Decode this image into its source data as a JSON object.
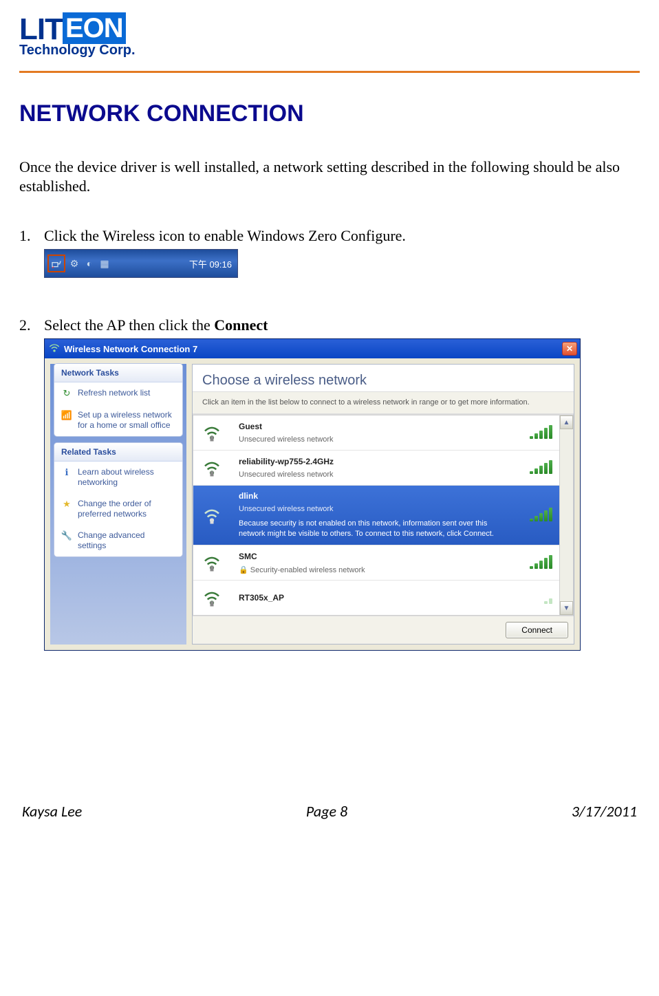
{
  "logo": {
    "brand1": "LIT",
    "brand2": "EON",
    "sub": "Technology Corp."
  },
  "heading": "NETWORK CONNECTION",
  "intro": "Once the device driver is well installed, a network setting described in the following should be also established.",
  "step1": {
    "num": "1.",
    "text": "Click the Wireless icon to enable Windows Zero Configure."
  },
  "tray_time": "下午 09:16",
  "step2": {
    "num": "2.",
    "text_a": "Select the AP then click the ",
    "text_b": "Connect"
  },
  "dlg": {
    "title": "Wireless Network Connection 7",
    "sidebar": {
      "tasks_h": "Network Tasks",
      "tasks": [
        {
          "icon": "↻",
          "label": "Refresh network list"
        },
        {
          "icon": "📶",
          "label": "Set up a wireless network for a home or small office"
        }
      ],
      "related_h": "Related Tasks",
      "related": [
        {
          "icon": "ℹ",
          "label": "Learn about wireless networking"
        },
        {
          "icon": "★",
          "label": "Change the order of preferred networks"
        },
        {
          "icon": "🔧",
          "label": "Change advanced settings"
        }
      ]
    },
    "main_h": "Choose a wireless network",
    "main_sub": "Click an item in the list below to connect to a wireless network in range or to get more information.",
    "networks": [
      {
        "ssid": "Guest",
        "desc": "Unsecured wireless network",
        "selected": false,
        "secure": false
      },
      {
        "ssid": "reliability-wp755-2.4GHz",
        "desc": "Unsecured wireless network",
        "selected": false,
        "secure": false
      },
      {
        "ssid": "dlink",
        "desc": "Unsecured wireless network",
        "selected": true,
        "secure": false,
        "warn": "Because security is not enabled on this network, information sent over this network might be visible to others. To connect to this network, click Connect."
      },
      {
        "ssid": "SMC",
        "desc": "Security-enabled wireless network",
        "selected": false,
        "secure": true
      },
      {
        "ssid": "RT305x_AP",
        "desc": "",
        "selected": false,
        "secure": false
      }
    ],
    "connect": "Connect"
  },
  "footer": {
    "author": "Kaysa Lee",
    "page": "Page 8",
    "date": "3/17/2011"
  }
}
